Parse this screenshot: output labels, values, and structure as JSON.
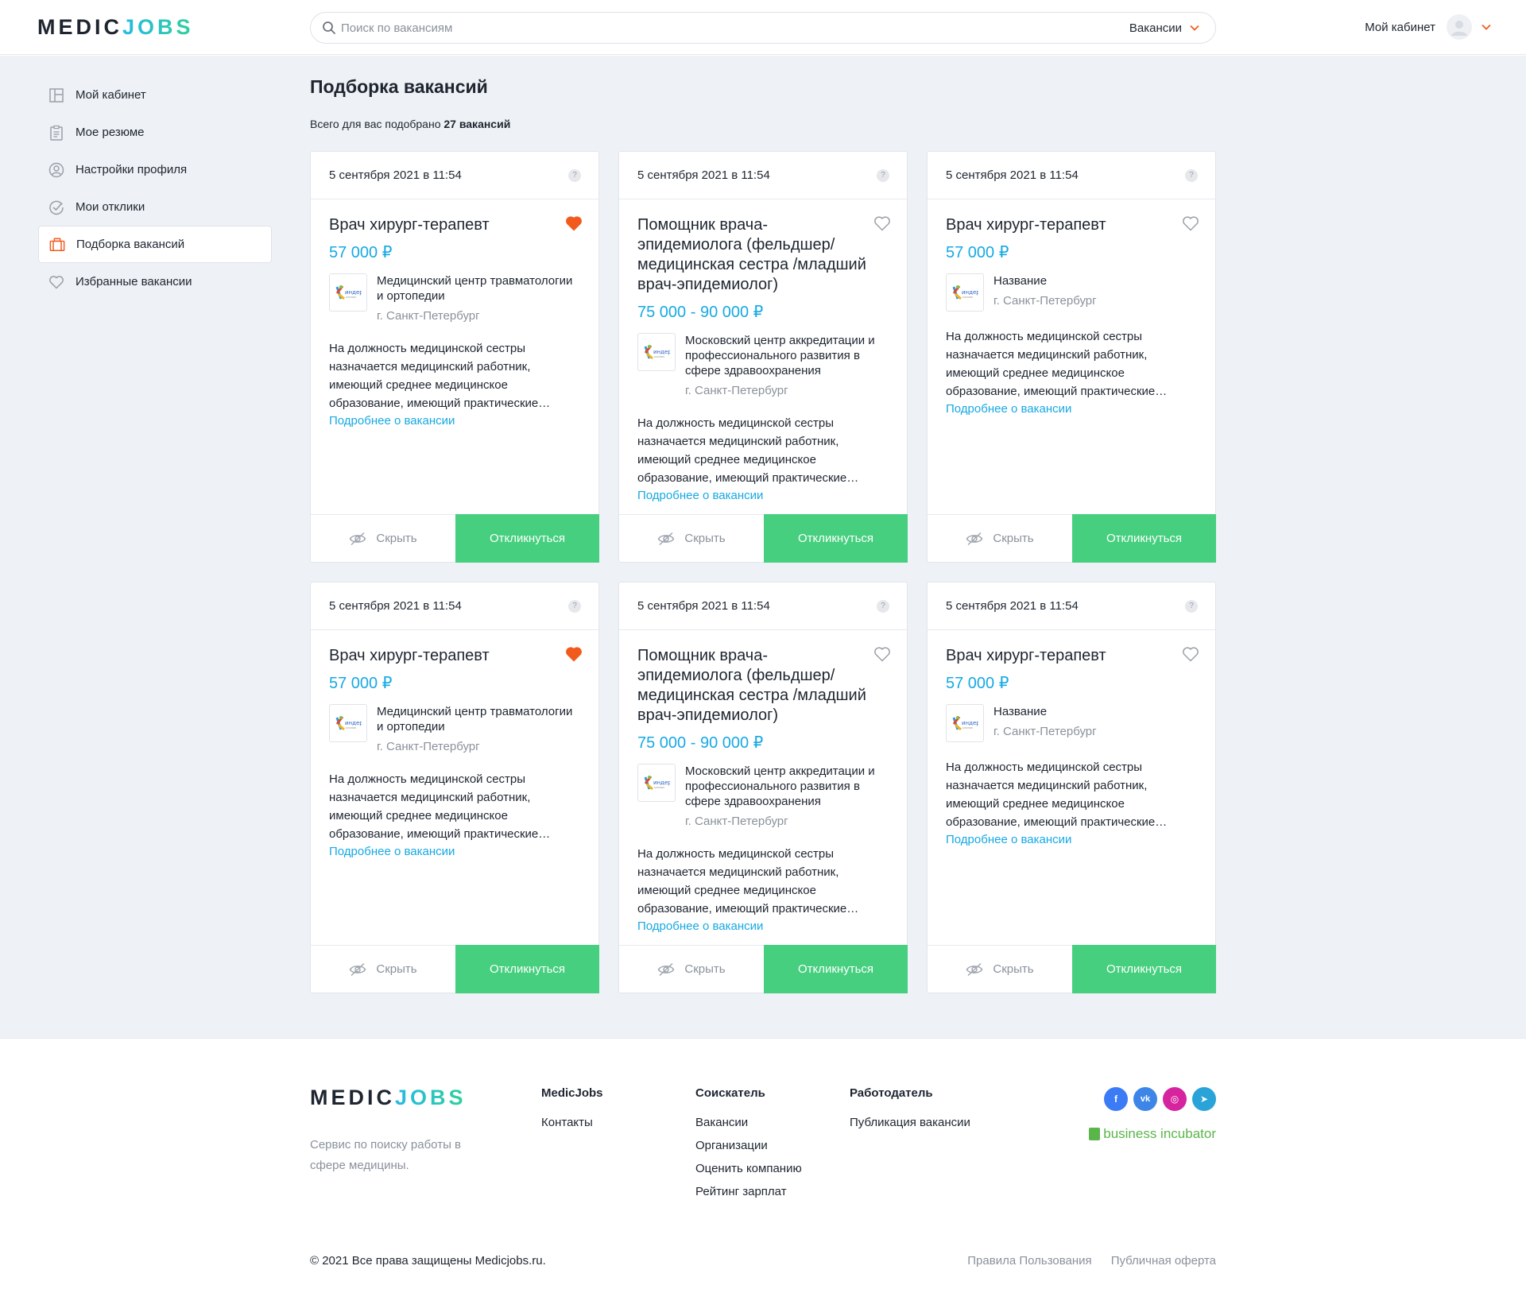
{
  "brand": {
    "logo_part1": "MEDIC",
    "logo_part2": "JOBS"
  },
  "header": {
    "search_placeholder": "Поиск по вакансиям",
    "search_value": "",
    "category": "Вакансии",
    "account_label": "Мой кабинет"
  },
  "sidebar": {
    "items": [
      {
        "label": "Мой кабинет",
        "icon": "dashboard-icon"
      },
      {
        "label": "Мое резюме",
        "icon": "resume-icon"
      },
      {
        "label": "Настройки профиля",
        "icon": "profile-settings-icon"
      },
      {
        "label": "Мои отклики",
        "icon": "check-circle-icon"
      },
      {
        "label": "Подборка вакансий",
        "icon": "briefcase-icon",
        "active": true
      },
      {
        "label": "Избранные вакансии",
        "icon": "heart-icon"
      }
    ]
  },
  "page": {
    "title": "Подборка вакансий",
    "subtitle_prefix": "Всего для вас подобрано",
    "subtitle_count": "27 вакансий"
  },
  "card_labels": {
    "more": "Подробнее о вакансии",
    "hide": "Скрыть",
    "apply": "Откликнуться",
    "help": "?"
  },
  "vacancies": [
    {
      "date": "5 сентября 2021 в 11:54",
      "title": "Врач хирург-терапевт",
      "salary": "57 000 ₽",
      "company": "Медицинский центр травматологии и ортопедии",
      "city": "г. Санкт-Петербург",
      "description": "На должность медицинской сестры назначается медицинский работник, имеющий среднее медицинское образование, имеющий практические…",
      "favorite": true
    },
    {
      "date": "5 сентября 2021 в 11:54",
      "title": "Помощник врача-эпидемиолога (фельдшер/ медицинская сестра /младший врач-эпидемиолог)",
      "salary": "75 000 - 90 000 ₽",
      "company": "Московский центр аккредитации и профессионального развития в сфере здравоохранения",
      "city": "г. Санкт-Петербург",
      "description": "На должность медицинской сестры назначается медицинский работник, имеющий среднее медицинское образование, имеющий практические…",
      "favorite": false
    },
    {
      "date": "5 сентября 2021 в 11:54",
      "title": "Врач хирург-терапевт",
      "salary": "57 000 ₽",
      "company": "Название",
      "city": "г. Санкт-Петербург",
      "description": "На должность медицинской сестры назначается медицинский работник, имеющий среднее медицинское образование, имеющий практические…",
      "favorite": false
    },
    {
      "date": "5 сентября 2021 в 11:54",
      "title": "Врач хирург-терапевт",
      "salary": "57 000 ₽",
      "company": "Медицинский центр травматологии и ортопедии",
      "city": "г. Санкт-Петербург",
      "description": "На должность медицинской сестры назначается медицинский работник, имеющий среднее медицинское образование, имеющий практические…",
      "favorite": true
    },
    {
      "date": "5 сентября 2021 в 11:54",
      "title": "Помощник врача-эпидемиолога (фельдшер/ медицинская сестра /младший врач-эпидемиолог)",
      "salary": "75 000 - 90 000 ₽",
      "company": "Московский центр аккредитации и профессионального развития в сфере здравоохранения",
      "city": "г. Санкт-Петербург",
      "description": "На должность медицинской сестры назначается медицинский работник, имеющий среднее медицинское образование, имеющий практические…",
      "favorite": false
    },
    {
      "date": "5 сентября 2021 в 11:54",
      "title": "Врач хирург-терапевт",
      "salary": "57 000 ₽",
      "company": "Название",
      "city": "г. Санкт-Петербург",
      "description": "На должность медицинской сестры назначается медицинский работник, имеющий среднее медицинское образование, имеющий практические…",
      "favorite": false
    }
  ],
  "footer": {
    "tagline": "Сервис по поиску работы в сфере медицины.",
    "columns": [
      {
        "title": "MedicJobs",
        "links": [
          "Контакты"
        ]
      },
      {
        "title": "Соискатель",
        "links": [
          "Вакансии",
          "Организации",
          "Оценить компанию",
          "Рейтинг зарплат"
        ]
      },
      {
        "title": "Работодатель",
        "links": [
          "Публикация вакансии"
        ]
      }
    ],
    "socials": [
      {
        "name": "facebook-icon",
        "glyph": "f",
        "color": "#3b7bf6"
      },
      {
        "name": "vk-icon",
        "glyph": "vk",
        "color": "#3d86e8"
      },
      {
        "name": "instagram-icon",
        "glyph": "◎",
        "color": "#d6249f"
      },
      {
        "name": "telegram-icon",
        "glyph": "➤",
        "color": "#2aa3d8"
      }
    ],
    "incubator": "business incubator",
    "copyright": "© 2021 Все права защищены Medicjobs.ru.",
    "legal_links": [
      "Правила Пользования",
      "Публичная оферта"
    ]
  },
  "colors": {
    "accent": "#16a9e3",
    "apply": "#45cf7e",
    "favorite": "#f25a1d",
    "background": "#eef1f5"
  }
}
